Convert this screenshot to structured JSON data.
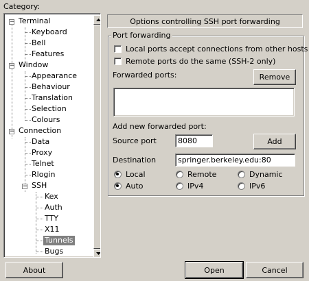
{
  "category_label": "Category:",
  "tree": {
    "items": [
      {
        "label": "Terminal"
      },
      {
        "label": "Keyboard"
      },
      {
        "label": "Bell"
      },
      {
        "label": "Features"
      },
      {
        "label": "Window"
      },
      {
        "label": "Appearance"
      },
      {
        "label": "Behaviour"
      },
      {
        "label": "Translation"
      },
      {
        "label": "Selection"
      },
      {
        "label": "Colours"
      },
      {
        "label": "Connection"
      },
      {
        "label": "Data"
      },
      {
        "label": "Proxy"
      },
      {
        "label": "Telnet"
      },
      {
        "label": "Rlogin"
      },
      {
        "label": "SSH"
      },
      {
        "label": "Kex"
      },
      {
        "label": "Auth"
      },
      {
        "label": "TTY"
      },
      {
        "label": "X11"
      },
      {
        "label": "Tunnels"
      },
      {
        "label": "Bugs"
      }
    ],
    "selected": "Tunnels",
    "expander_minus": "−"
  },
  "panel": {
    "header": "Options controlling SSH port forwarding",
    "group_title": "Port forwarding",
    "check_local": "Local ports accept connections from other hosts",
    "check_remote": "Remote ports do the same (SSH-2 only)",
    "forwarded_ports_label": "Forwarded ports:",
    "remove_button": "Remove",
    "add_new_label": "Add new forwarded port:",
    "source_port_label": "Source port",
    "source_port_value": "8080",
    "add_button": "Add",
    "destination_label": "Destination",
    "destination_value": "springer.berkeley.edu:80",
    "radio_local": "Local",
    "radio_remote": "Remote",
    "radio_dynamic": "Dynamic",
    "radio_auto": "Auto",
    "radio_ipv4": "IPv4",
    "radio_ipv6": "IPv6"
  },
  "buttons": {
    "about": "About",
    "open": "Open",
    "cancel": "Cancel"
  },
  "icons": {
    "scroll_up": "triangle-up-icon",
    "scroll_down": "triangle-down-icon"
  }
}
